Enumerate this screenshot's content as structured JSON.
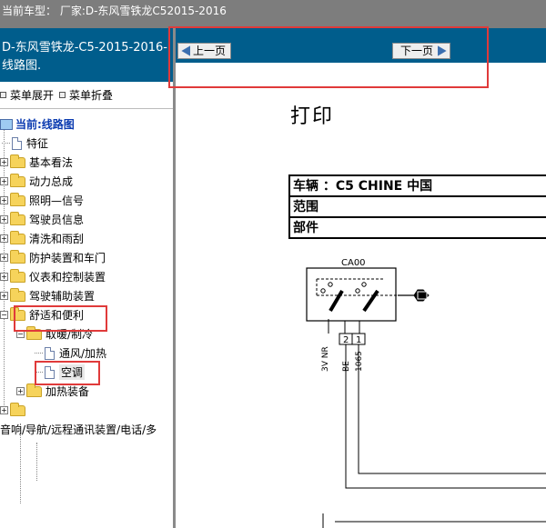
{
  "topbar": {
    "text": "当前车型： 厂家:D-东风雪铁龙C52015-2016"
  },
  "left_panel": {
    "title": "D-东风雪铁龙-C5-2015-2016- 线路图.",
    "menu_expand": "菜单展开",
    "menu_collapse": "菜单折叠",
    "tree": {
      "current": "当前:线路图",
      "items": [
        "特征",
        "基本看法",
        "动力总成",
        "照明—信号",
        "驾驶员信息",
        "清洗和雨刮",
        "防护装置和车门",
        "仪表和控制装置",
        "驾驶辅助装置",
        "舒适和便利",
        "取暖/制冷",
        "通风/加热",
        "空调",
        "加热装备",
        "音响/导航/远程通讯装置/电话/多"
      ]
    }
  },
  "right_panel": {
    "prev_label": "上一页",
    "next_label": "下一页",
    "print_title": "打印",
    "table": {
      "vehicle": "车辆 ：C5 CHINE 中国",
      "scope": "范围",
      "component": "部件"
    },
    "diagram": {
      "component_id": "CA00",
      "pin2": "2",
      "pin1": "1",
      "wire_left": "3V NR",
      "wire_mid": "BE",
      "wire_right": "1065"
    }
  },
  "colors": {
    "topbar": "#7d7d7d",
    "panel_header": "#005d8c",
    "highlight_box": "#e03a3a",
    "folder": "#f6d35b"
  }
}
